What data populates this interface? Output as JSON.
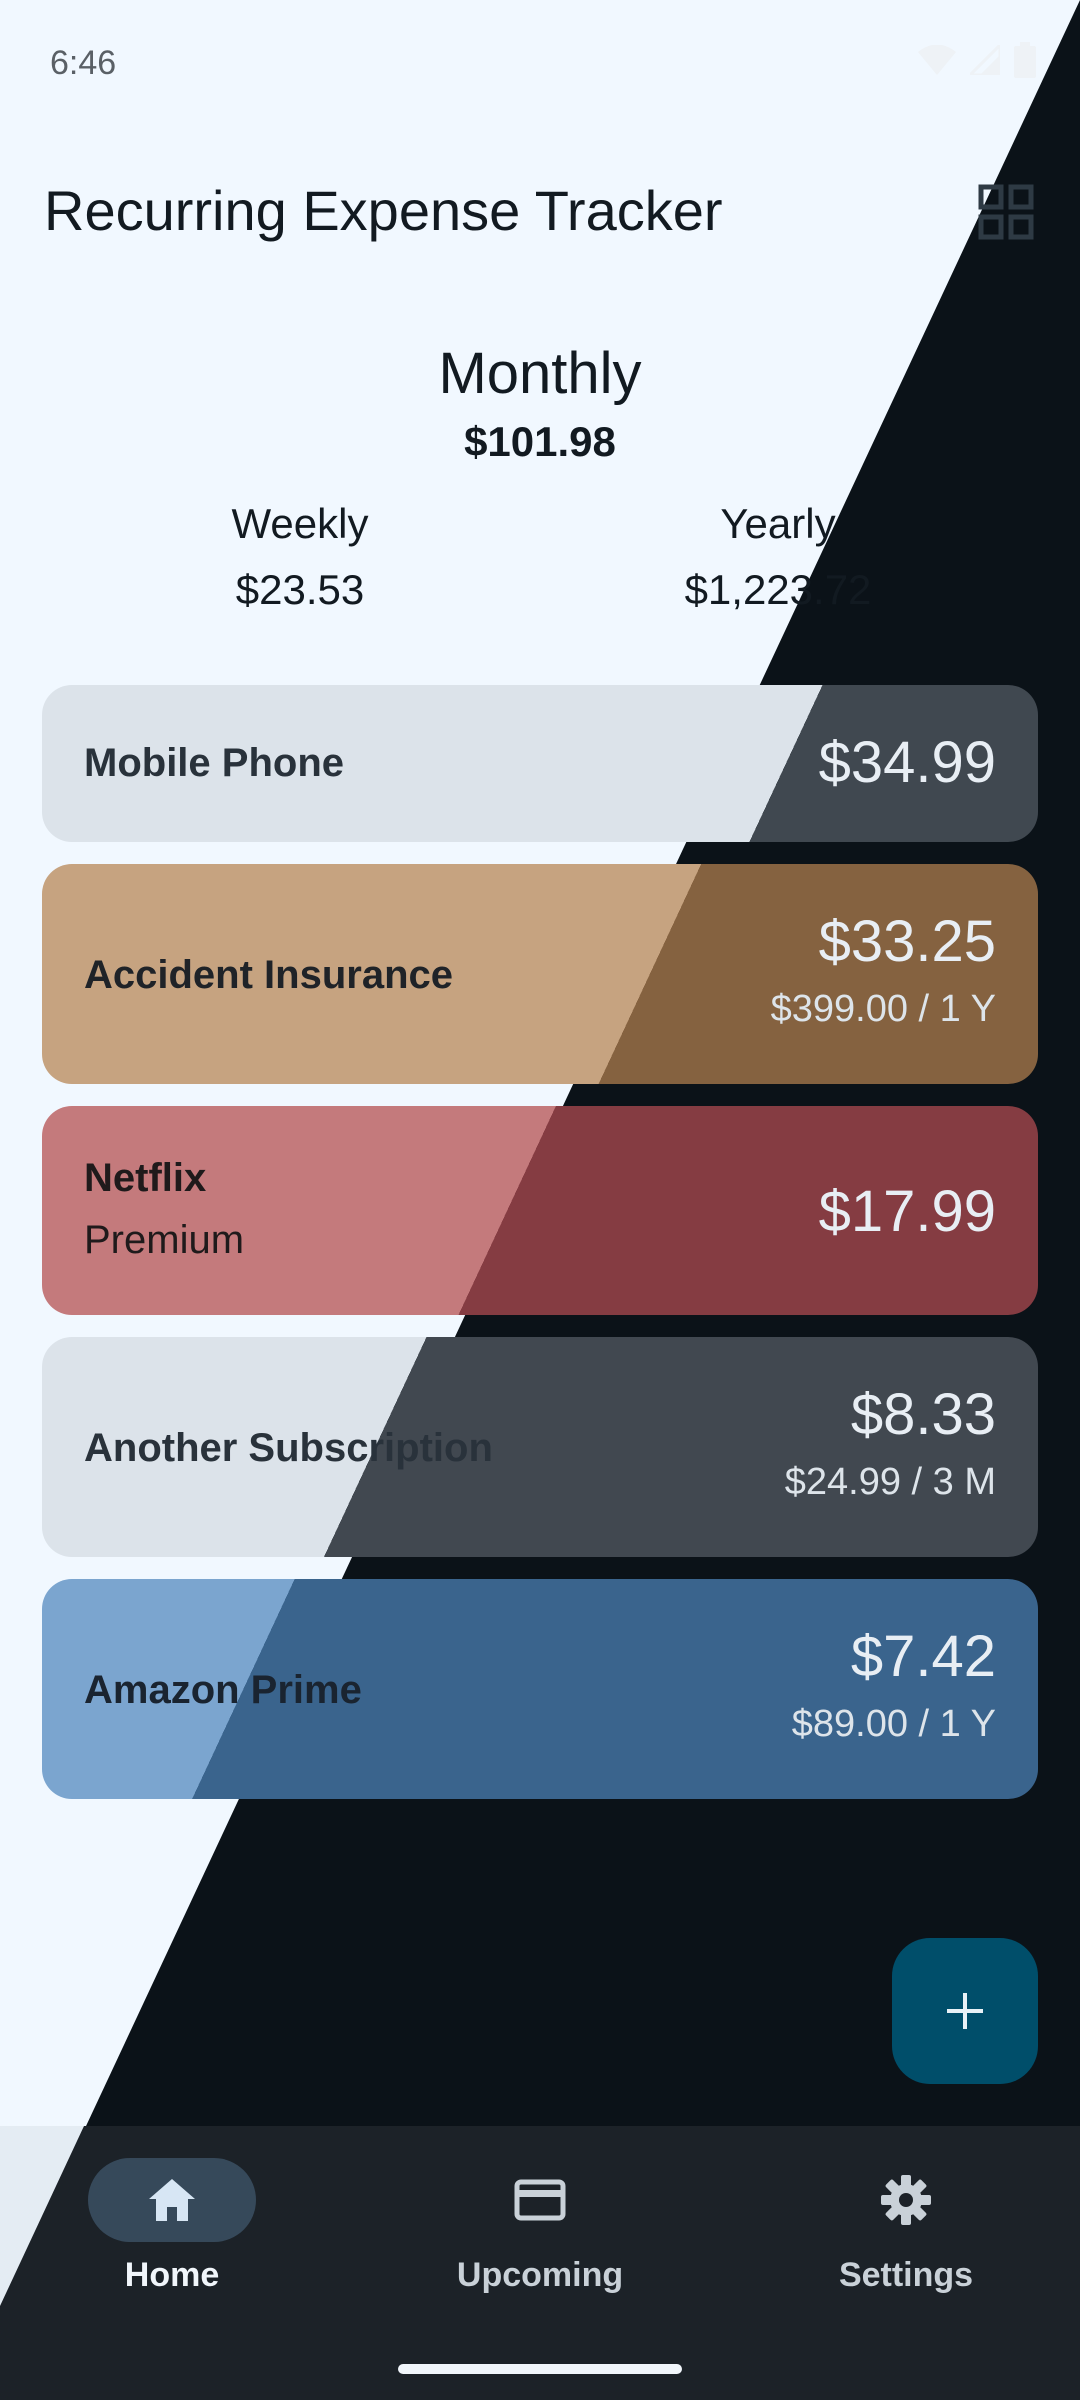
{
  "status_bar": {
    "time": "6:46"
  },
  "app": {
    "title": "Recurring Expense Tracker"
  },
  "summary": {
    "monthly_label": "Monthly",
    "monthly_value": "$101.98",
    "weekly_label": "Weekly",
    "weekly_value": "$23.53",
    "yearly_label": "Yearly",
    "yearly_value": "$1,223.72"
  },
  "expenses": [
    {
      "name": "Mobile Phone",
      "description": "",
      "amount": "$34.99",
      "secondary": "",
      "color": "#dce3ea"
    },
    {
      "name": "Accident Insurance",
      "description": "",
      "amount": "$33.25",
      "secondary": "$399.00 / 1 Y",
      "color": "#c6a380"
    },
    {
      "name": "Netflix",
      "description": "Premium",
      "amount": "$17.99",
      "secondary": "",
      "color": "#c47a7c"
    },
    {
      "name": "Another Subscription",
      "description": "",
      "amount": "$8.33",
      "secondary": "$24.99 / 3 M",
      "color": "#dce3ea"
    },
    {
      "name": "Amazon Prime",
      "description": "",
      "amount": "$7.42",
      "secondary": "$89.00 / 1 Y",
      "color": "#7ba5cf"
    }
  ],
  "fab": {
    "icon": "plus-icon"
  },
  "nav": {
    "items": [
      {
        "label": "Home",
        "icon": "home-icon",
        "active": true
      },
      {
        "label": "Upcoming",
        "icon": "card-icon",
        "active": false
      },
      {
        "label": "Settings",
        "icon": "gear-icon",
        "active": false
      }
    ]
  }
}
